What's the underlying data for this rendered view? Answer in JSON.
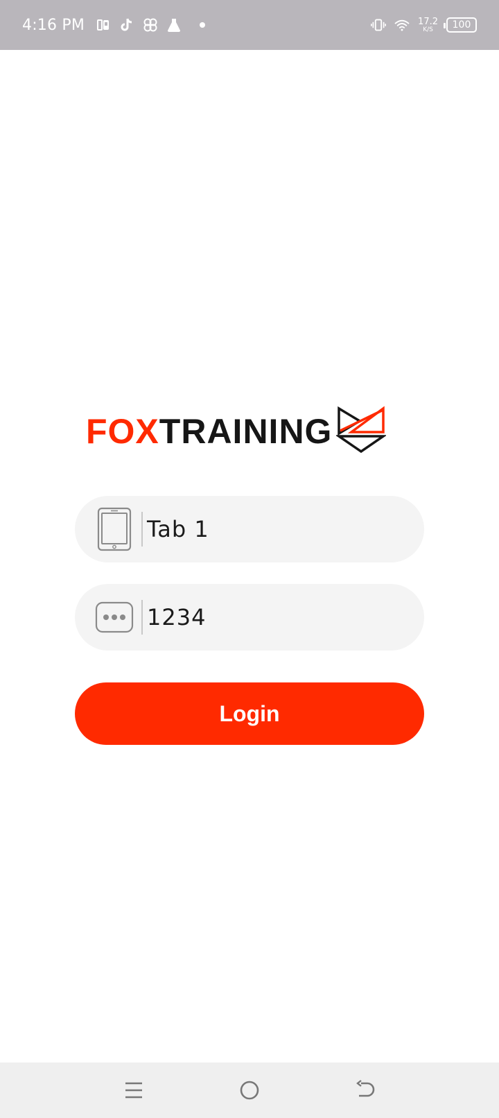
{
  "status_bar": {
    "time": "4:16 PM",
    "net_speed_value": "17.2",
    "net_speed_unit": "K/S",
    "battery": "100",
    "icons": [
      "pocket-icon",
      "tiktok-icon",
      "pinwheel-icon",
      "flask-icon",
      "notification-dot",
      "vibrate-icon",
      "wifi-icon",
      "battery-icon"
    ]
  },
  "logo": {
    "part1": "FOX",
    "part2": "TRAINING"
  },
  "form": {
    "device_field": {
      "value": "Tab 1",
      "icon": "tablet-icon"
    },
    "pin_field": {
      "value": "1234",
      "icon": "password-dots-icon"
    },
    "login_label": "Login"
  },
  "nav_bar": {
    "icons": [
      "menu-icon",
      "home-icon",
      "back-icon"
    ]
  },
  "colors": {
    "accent": "#ff2a00",
    "status_bar_bg": "#b9b6bb",
    "field_bg": "#f4f4f4",
    "nav_bar_bg": "#efefef"
  }
}
